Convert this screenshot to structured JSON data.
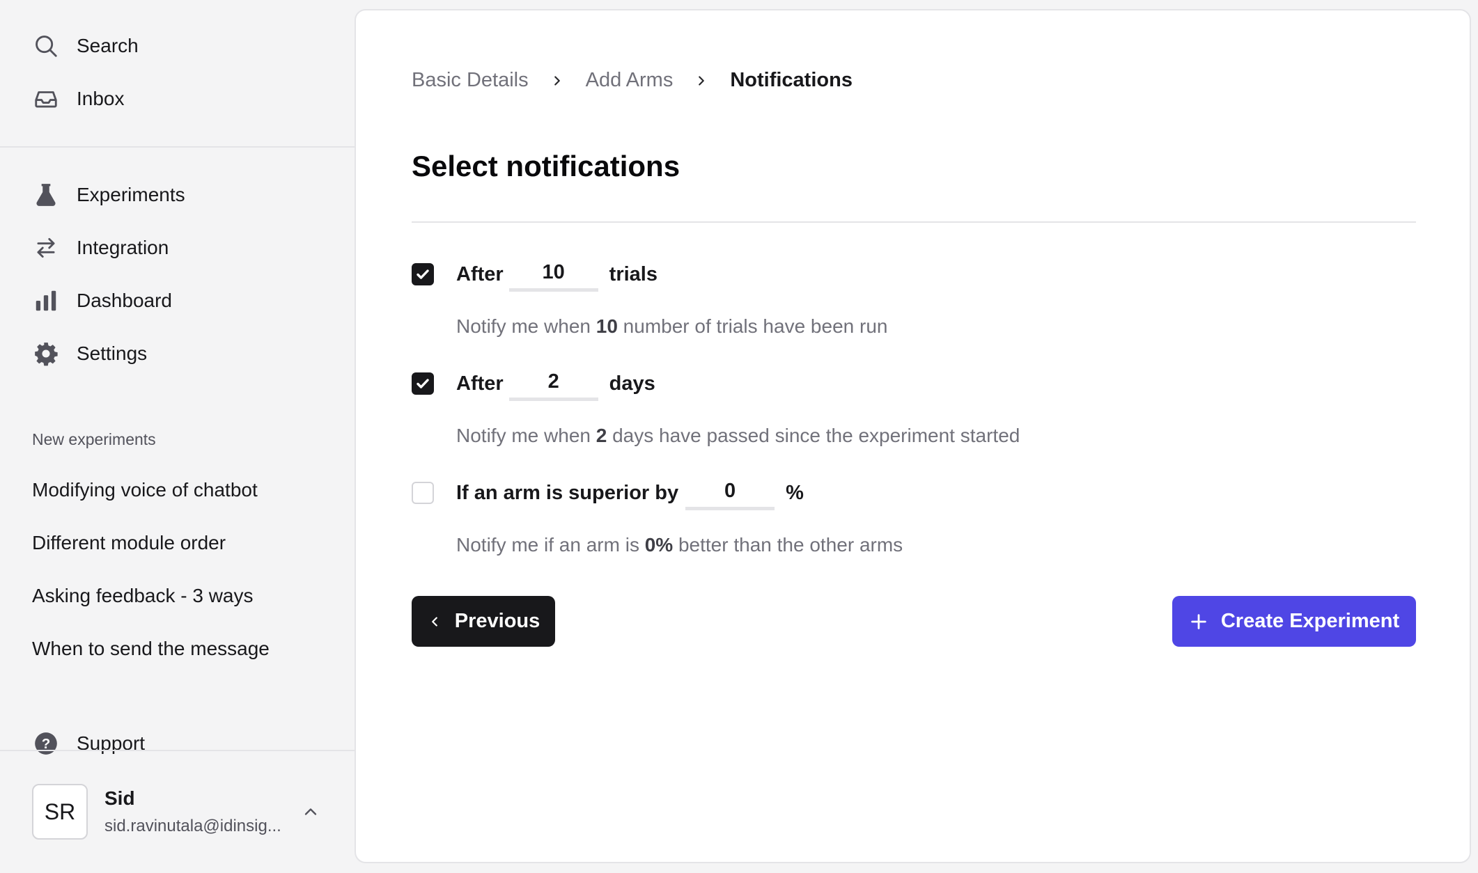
{
  "sidebar": {
    "top_nav": [
      {
        "label": "Search",
        "icon": "search-icon"
      },
      {
        "label": "Inbox",
        "icon": "inbox-icon"
      }
    ],
    "main_nav": [
      {
        "label": "Experiments",
        "icon": "flask-icon"
      },
      {
        "label": "Integration",
        "icon": "arrows-exchange-icon"
      },
      {
        "label": "Dashboard",
        "icon": "bar-chart-icon"
      },
      {
        "label": "Settings",
        "icon": "gear-icon"
      }
    ],
    "section_label": "New experiments",
    "experiments": [
      "Modifying voice of chatbot",
      "Different module order",
      "Asking feedback - 3 ways",
      "When to send the message"
    ],
    "support": {
      "label": "Support",
      "icon": "question-circle-icon"
    },
    "user": {
      "initials": "SR",
      "name": "Sid",
      "email": "sid.ravinutala@idinsig..."
    }
  },
  "breadcrumb": {
    "items": [
      "Basic Details",
      "Add Arms",
      "Notifications"
    ],
    "active_index": 2
  },
  "page_title": "Select notifications",
  "notifications": [
    {
      "checked": true,
      "prefix": "After",
      "value": "10",
      "suffix": "trials",
      "helper_pre": "Notify me when ",
      "helper_value": "10",
      "helper_post": " number of trials have been run"
    },
    {
      "checked": true,
      "prefix": "After",
      "value": "2",
      "suffix": "days",
      "helper_pre": "Notify me when ",
      "helper_value": "2",
      "helper_post": " days have passed since the experiment started"
    },
    {
      "checked": false,
      "prefix": "If an arm is superior by",
      "value": "0",
      "suffix": "%",
      "helper_pre": "Notify me if an arm is ",
      "helper_value": "0%",
      "helper_post": " better than the other arms"
    }
  ],
  "buttons": {
    "previous": "Previous",
    "create": "Create Experiment"
  },
  "colors": {
    "accent": "#4f46e5",
    "dark": "#18181b",
    "muted": "#71717a"
  }
}
